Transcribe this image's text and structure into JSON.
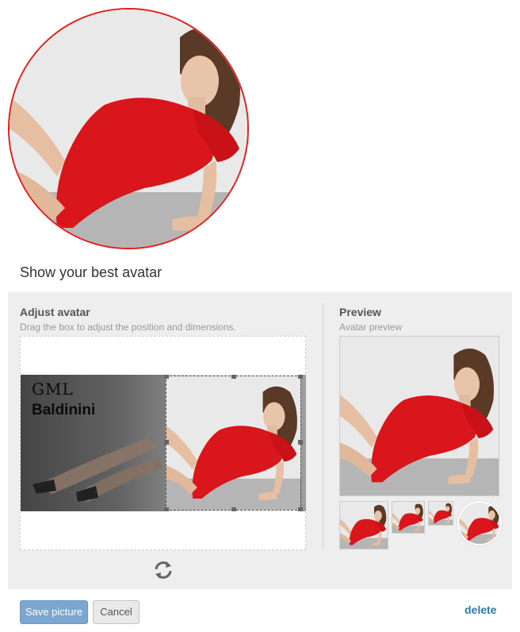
{
  "page": {
    "section_title": "Show your best avatar"
  },
  "adjust": {
    "heading": "Adjust avatar",
    "instructions": "Drag the box to adjust the position and dimensions.",
    "image_logo_text": "GML",
    "image_brand_text": "Baldinini"
  },
  "preview": {
    "heading": "Preview",
    "subheading": "Avatar preview"
  },
  "actions": {
    "save_label": "Save picture",
    "cancel_label": "Cancel",
    "delete_label": "delete"
  },
  "colors": {
    "avatar_border": "#e41c1c",
    "primary_button": "#7aa6cf",
    "link": "#2a7ab0",
    "panel_bg": "#eeeeee"
  },
  "icons": {
    "rotate": "rotate-icon"
  }
}
